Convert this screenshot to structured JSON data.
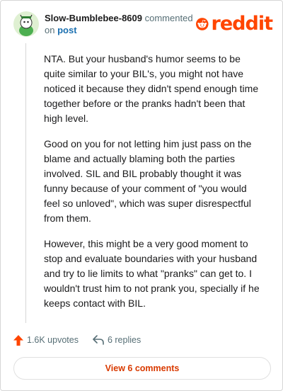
{
  "comment": {
    "username": "Slow-Bumblebee-8609",
    "action_text": "commented",
    "on_text": "on",
    "post_link": "post",
    "paragraphs": [
      "NTA. But your husband's humor seems to be quite similar to your BIL's, you might not have noticed it because they didn't spend enough time together before or the pranks hadn't been that high level.",
      "Good on you for not letting him just pass on the blame and actually blaming both the parties involved. SIL and BIL probably thought it was funny because of your comment of \"you would feel so unloved\", which was super disrespectful from them.",
      "However, this might be a very good moment to stop and evaluate boundaries with your husband and try to lie limits to what \"pranks\" can get to. I wouldn't trust him to not prank you, specially if he keeps contact with BIL."
    ],
    "upvotes": "1.6K upvotes",
    "replies": "6 replies"
  },
  "brand": {
    "logo_text": "reddit",
    "color": "#ff4500"
  },
  "footer": {
    "view_comments_label": "View 6 comments",
    "accent": "#d93a00"
  },
  "icons": [
    "avatar",
    "reddit-snoo-icon",
    "upvote-arrow-icon",
    "reply-arrow-icon"
  ]
}
